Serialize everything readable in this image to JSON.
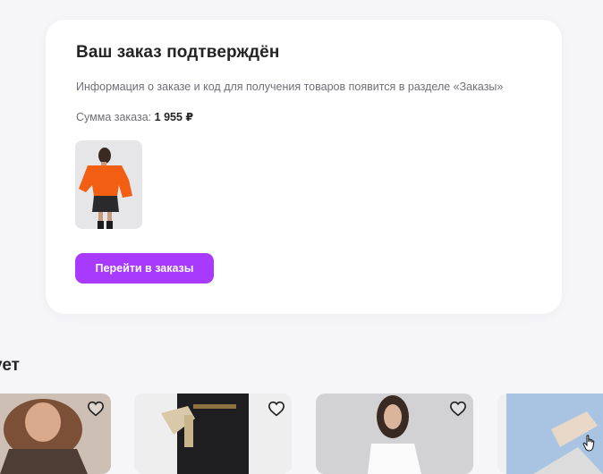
{
  "order": {
    "title": "Ваш заказ подтверждён",
    "info": "Информация о заказе и код для получения товаров появится в разделе «Заказы»",
    "sum_label": "Сумма заказа:",
    "sum_value": "1 955 ₽",
    "button_label": "Перейти в заказы"
  },
  "recommendations": {
    "title_fragment": "ует"
  },
  "colors": {
    "accent": "#a73afd",
    "background": "#f6f6f9",
    "card": "#ffffff"
  },
  "icons": [
    "heart-outline-icon",
    "hand-cursor-icon"
  ]
}
